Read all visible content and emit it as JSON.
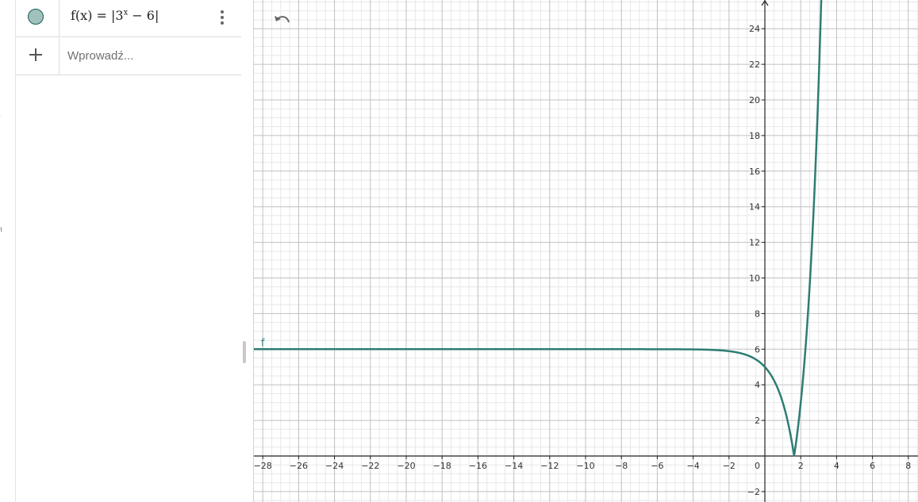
{
  "left_rail": {
    "fragment_1": "a",
    "fragment_2": "et"
  },
  "algebra": {
    "items": [
      {
        "icon": "marble-icon",
        "color": "#9fc2bd",
        "formula": {
          "prefix": "f(x)  =  |3",
          "superscript": "x",
          "suffix": " − 6|"
        },
        "menu_icon": "kebab-menu-icon"
      }
    ],
    "input": {
      "icon": "plus-icon",
      "placeholder": "Wprowadź..."
    }
  },
  "toolbar": {
    "undo_icon": "undo-icon"
  },
  "graph": {
    "x_ticks": [
      "−28",
      "−26",
      "−24",
      "−22",
      "−20",
      "−18",
      "−16",
      "−14",
      "−12",
      "−10",
      "−8",
      "−6",
      "−4",
      "−2",
      "2",
      "4",
      "6",
      "8"
    ],
    "y_ticks": [
      "−2",
      "2",
      "4",
      "6",
      "8",
      "10",
      "12",
      "14",
      "16",
      "18",
      "20",
      "22",
      "24"
    ],
    "origin_label": "0",
    "function_label": "f",
    "curve_color": "#2e7d72",
    "axis_color": "#222222",
    "major_grid_color": "#c0c0c0",
    "minor_grid_color": "#e8e8e8",
    "function": {
      "base": 3,
      "offset": 6,
      "abs": true
    }
  }
}
